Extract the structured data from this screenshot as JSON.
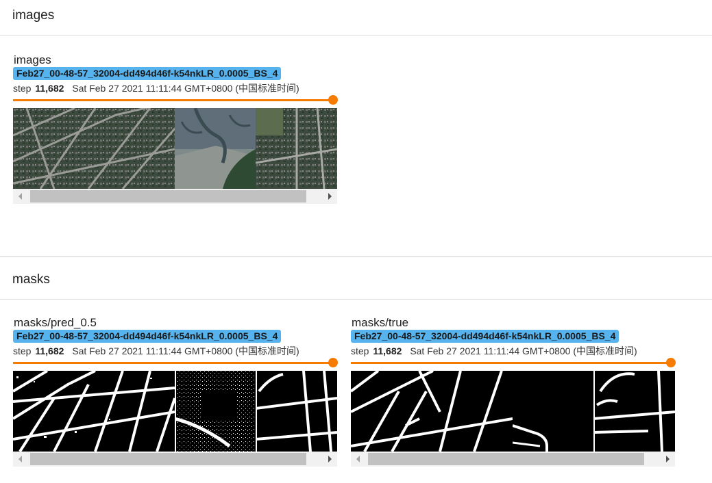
{
  "sections": {
    "images": {
      "title": "images",
      "card": {
        "tag": "images",
        "run": "Feb27_00-48-57_32004-dd494d46f-k54nkLR_0.0005_BS_4",
        "step_label": "step",
        "step_value": "11,682",
        "timestamp": "Sat Feb 27 2021 11:11:44 GMT+0800 (中国标准时间)"
      }
    },
    "masks": {
      "title": "masks",
      "cards": [
        {
          "tag": "masks/pred_0.5",
          "run": "Feb27_00-48-57_32004-dd494d46f-k54nkLR_0.0005_BS_4",
          "step_label": "step",
          "step_value": "11,682",
          "timestamp": "Sat Feb 27 2021 11:11:44 GMT+0800 (中国标准时间)"
        },
        {
          "tag": "masks/true",
          "run": "Feb27_00-48-57_32004-dd494d46f-k54nkLR_0.0005_BS_4",
          "step_label": "step",
          "step_value": "11,682",
          "timestamp": "Sat Feb 27 2021 11:11:44 GMT+0800 (中国标准时间)"
        }
      ]
    }
  },
  "colors": {
    "run_chip": "#56b3ee",
    "slider": "#f57c00",
    "scroll_thumb": "#c1c1c1"
  },
  "icons": [
    "scroll-left-arrow-icon",
    "scroll-right-arrow-icon"
  ]
}
